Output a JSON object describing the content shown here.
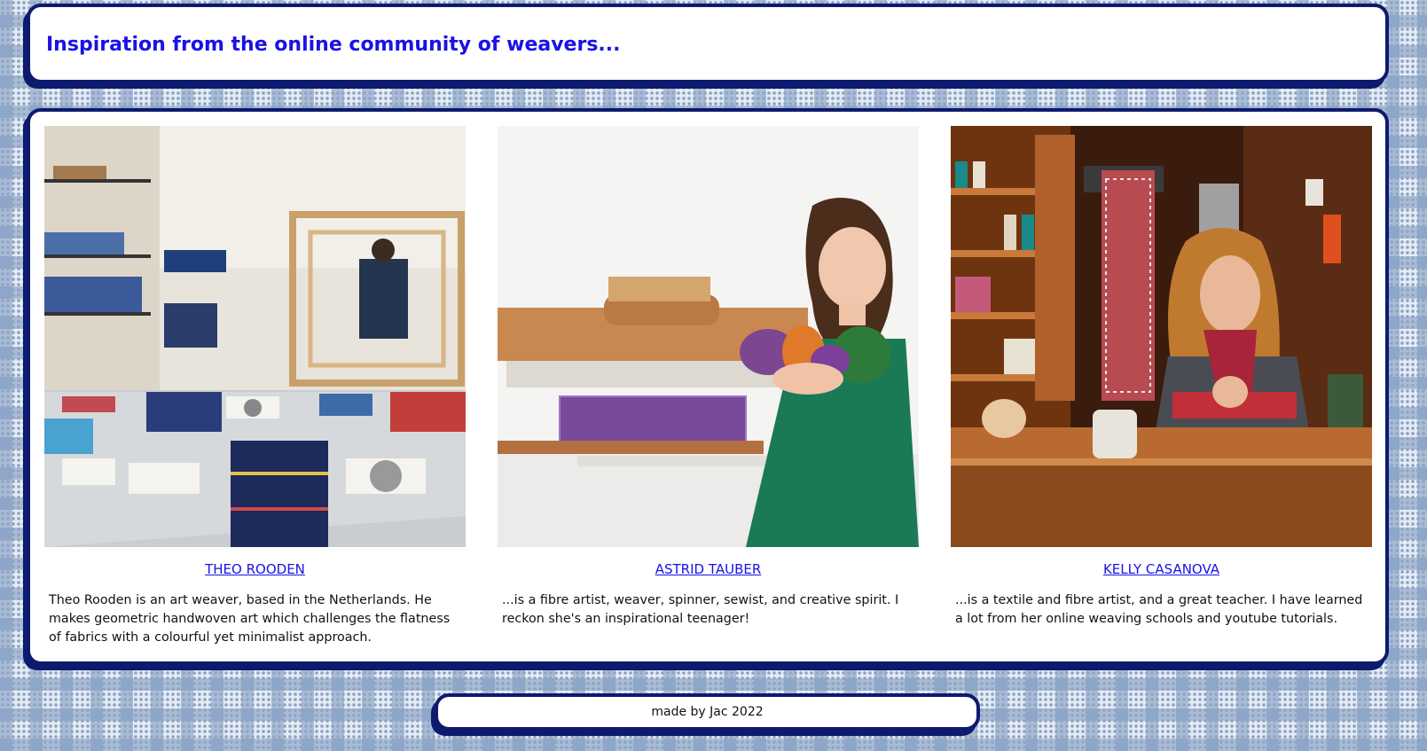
{
  "header": {
    "title": "Inspiration from the online community of weavers..."
  },
  "weavers": [
    {
      "name": "THEO ROODEN",
      "description": "Theo Rooden is an art weaver, based in the Netherlands. He makes geometric handwoven art which challenges the flatness of fabrics with a colourful yet minimalist approach."
    },
    {
      "name": "ASTRID TAUBER",
      "description": "...is a fibre artist, weaver, spinner, sewist, and creative spirit. I reckon she's an inspirational teenager!"
    },
    {
      "name": "KELLY CASANOVA",
      "description": "...is a textile and fibre artist, and a great teacher. I have learned a lot from her online weaving schools and youtube tutorials."
    }
  ],
  "footer": {
    "text": "made by Jac 2022"
  },
  "colors": {
    "accent": "#1a12e6",
    "border": "#0d1a6e"
  }
}
